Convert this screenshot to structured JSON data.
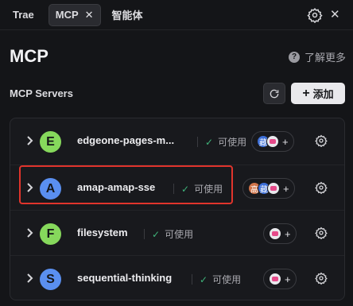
{
  "tabs": [
    {
      "label": "Trae"
    },
    {
      "label": "MCP",
      "close": "✕"
    },
    {
      "label": "智能体"
    }
  ],
  "window": {
    "close": "✕"
  },
  "page": {
    "title": "MCP",
    "learn_more": "了解更多",
    "learn_icon": "?"
  },
  "section": {
    "title": "MCP Servers",
    "add_label": "添加",
    "add_icon": "+"
  },
  "servers": [
    {
      "letter": "E",
      "name": "edgeone-pages-m...",
      "status": "可使用",
      "color": "#86d85c",
      "chips": [
        "藏",
        "pink"
      ]
    },
    {
      "letter": "A",
      "name": "amap-amap-sse",
      "status": "可使用",
      "color": "#5a8ff0",
      "chips": [
        "高",
        "藏",
        "pink"
      ]
    },
    {
      "letter": "F",
      "name": "filesystem",
      "status": "可使用",
      "color": "#86d85c",
      "chips": [
        "pink"
      ]
    },
    {
      "letter": "S",
      "name": "sequential-thinking",
      "status": "可使用",
      "color": "#5a8ff0",
      "chips": [
        "pink"
      ]
    }
  ],
  "chip_colors": {
    "藏": "#3d6fd8",
    "高": "#d0744a"
  },
  "pill_plus": "+"
}
